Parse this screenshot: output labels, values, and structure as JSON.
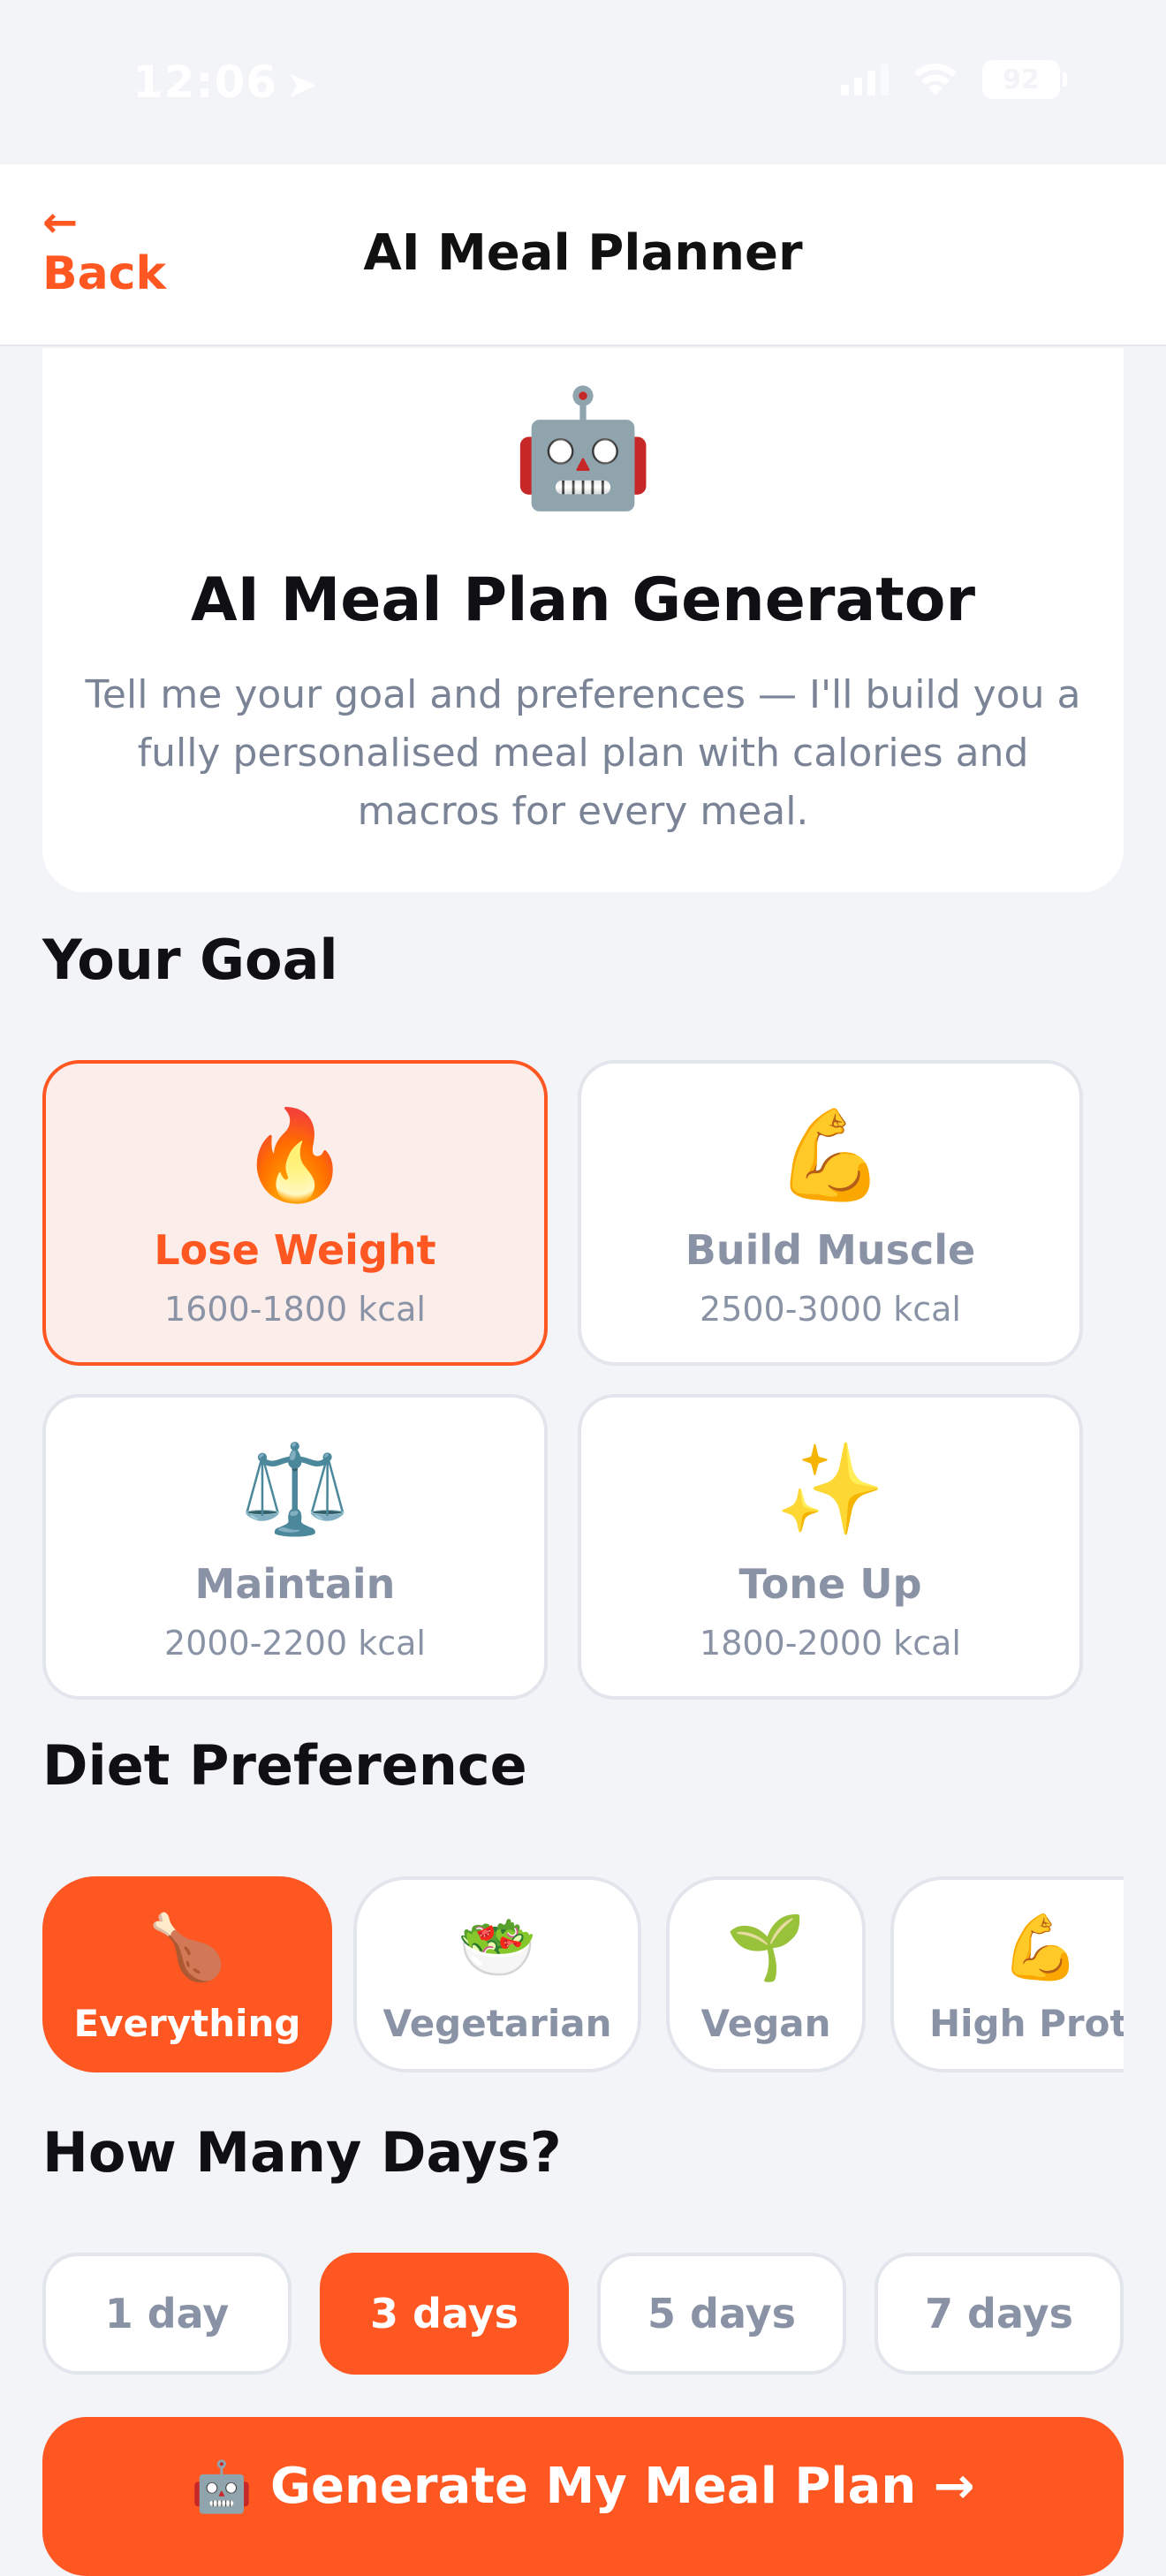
{
  "status_bar": {
    "time": "12:06",
    "location_glyph": "➤",
    "battery": "92"
  },
  "nav": {
    "back_arrow": "←",
    "back_label": "Back",
    "title": "AI Meal Planner"
  },
  "hero": {
    "emoji": "🤖",
    "title": "AI Meal Plan Generator",
    "subtitle": "Tell me your goal and preferences — I'll build you a fully personalised meal plan with calories and macros for every meal."
  },
  "goal": {
    "title": "Your Goal",
    "options": [
      {
        "emoji": "🔥",
        "label": "Lose Weight",
        "kcal": "1600-1800 kcal",
        "selected": true
      },
      {
        "emoji": "💪",
        "label": "Build Muscle",
        "kcal": "2500-3000 kcal",
        "selected": false
      },
      {
        "emoji": "⚖️",
        "label": "Maintain",
        "kcal": "2000-2200 kcal",
        "selected": false
      },
      {
        "emoji": "✨",
        "label": "Tone Up",
        "kcal": "1800-2000 kcal",
        "selected": false
      }
    ]
  },
  "diet": {
    "title": "Diet Preference",
    "options": [
      {
        "emoji": "🍗",
        "label": "Everything",
        "selected": true
      },
      {
        "emoji": "🥗",
        "label": "Vegetarian",
        "selected": false
      },
      {
        "emoji": "🌱",
        "label": "Vegan",
        "selected": false
      },
      {
        "emoji": "💪",
        "label": "High Prote",
        "selected": false
      }
    ]
  },
  "days": {
    "title": "How Many Days?",
    "options": [
      {
        "label": "1 day",
        "selected": false
      },
      {
        "label": "3 days",
        "selected": true
      },
      {
        "label": "5 days",
        "selected": false
      },
      {
        "label": "7 days",
        "selected": false
      }
    ]
  },
  "generate": {
    "emoji": "🤖",
    "label": "Generate My Meal Plan →"
  },
  "colors": {
    "accent": "#ff5722",
    "background": "#f3f4f8",
    "muted_text": "#8a93a6"
  }
}
